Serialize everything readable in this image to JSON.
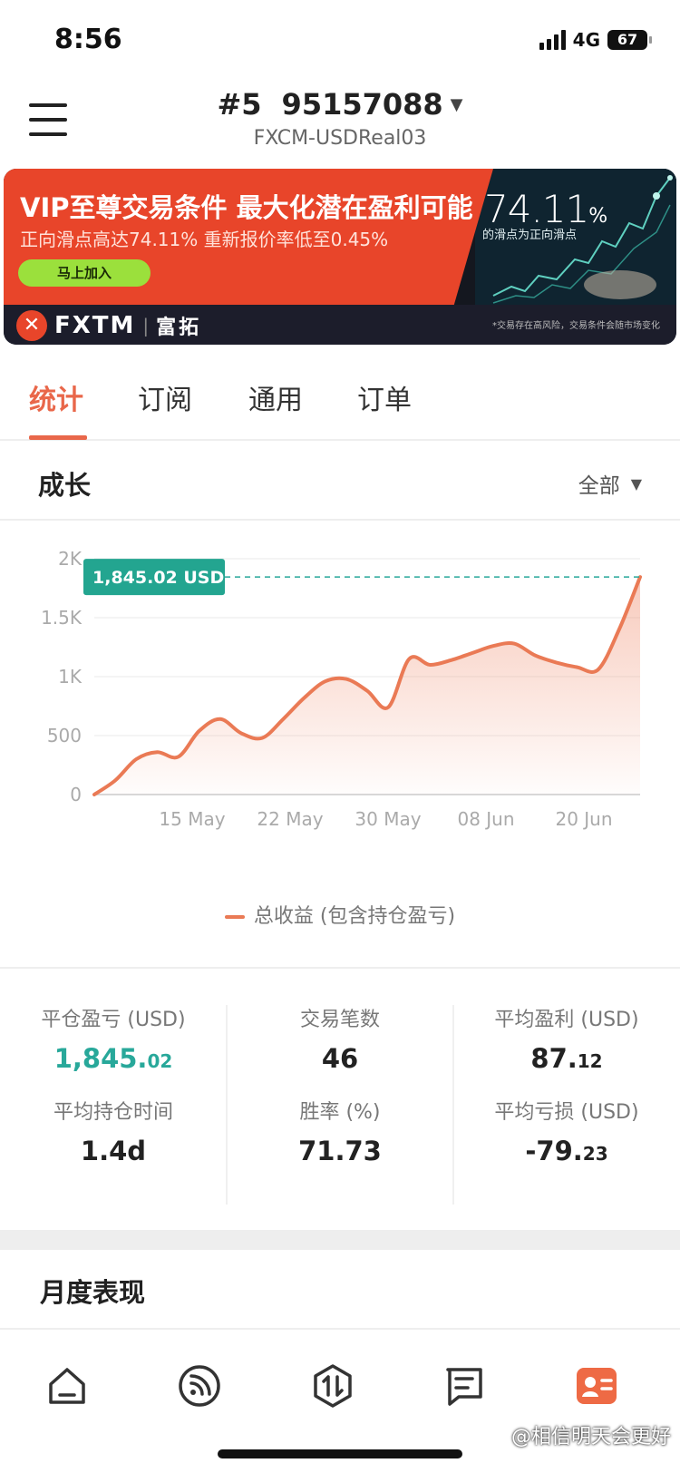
{
  "status_bar": {
    "time": "8:56",
    "network": "4G",
    "battery": "67"
  },
  "header": {
    "account_rank": "#5",
    "account_number": "95157088",
    "server": "FXCM-USDReal03"
  },
  "banner": {
    "title": "VIP至尊交易条件 最大化潜在盈利可能",
    "subtitle": "正向滑点高达74.11% 重新报价率低至0.45%",
    "cta": "马上加入",
    "big_percent_value": "74.11",
    "big_percent_symbol": "%",
    "percent_label": "的滑点为正向滑点",
    "brand": "FXTM",
    "brand_separator": "|",
    "brand_cn": "富拓",
    "disclaimer": "*交易存在高风险，交易条件会随市场变化"
  },
  "tabs": [
    {
      "label": "统计",
      "active": true
    },
    {
      "label": "订阅",
      "active": false
    },
    {
      "label": "通用",
      "active": false
    },
    {
      "label": "订单",
      "active": false
    }
  ],
  "growth": {
    "title": "成长",
    "filter": "全部"
  },
  "chart_data": {
    "type": "area",
    "title": "",
    "xlabel": "",
    "ylabel": "",
    "ylim": [
      0,
      2000
    ],
    "y_ticks": [
      "0",
      "500",
      "1K",
      "1.5K",
      "2K"
    ],
    "x_tick_labels": [
      "15 May",
      "22 May",
      "30 May",
      "08 Jun",
      "20 Jun"
    ],
    "series": [
      {
        "name": "总收益 (包含持仓盈亏)",
        "color": "#ea7a55",
        "x": [
          "05-05",
          "05-07",
          "05-09",
          "05-11",
          "05-13",
          "05-15",
          "05-17",
          "05-19",
          "05-21",
          "05-23",
          "05-25",
          "05-27",
          "05-29",
          "05-31",
          "06-02",
          "06-04",
          "06-06",
          "06-08",
          "06-10",
          "06-12",
          "06-14",
          "06-16",
          "06-18",
          "06-20",
          "06-22",
          "06-24",
          "06-26"
        ],
        "values": [
          0,
          120,
          300,
          360,
          320,
          540,
          640,
          520,
          480,
          640,
          820,
          960,
          980,
          880,
          740,
          1150,
          1100,
          1140,
          1200,
          1260,
          1280,
          1180,
          1120,
          1080,
          1060,
          1400,
          1845.02
        ]
      }
    ],
    "current_value_label": "1,845.02 USD",
    "legend_position": "bottom"
  },
  "stats": [
    {
      "label": "平仓盈亏 (USD)",
      "int": "1,845.",
      "dec": "02",
      "green": true
    },
    {
      "label": "交易笔数",
      "int": "46",
      "dec": "",
      "green": false
    },
    {
      "label": "平均盈利 (USD)",
      "int": "87.",
      "dec": "12",
      "green": false
    },
    {
      "label": "平均持仓时间",
      "int": "1.4d",
      "dec": "",
      "green": false
    },
    {
      "label": "胜率 (%)",
      "int": "71.73",
      "dec": "",
      "green": false
    },
    {
      "label": "平均亏损 (USD)",
      "int": "-79.",
      "dec": "23",
      "green": false
    }
  ],
  "monthly": {
    "title": "月度表现"
  },
  "bottom_nav": [
    {
      "icon": "home-icon",
      "active": false
    },
    {
      "icon": "feed-icon",
      "active": false
    },
    {
      "icon": "trade-icon",
      "active": false
    },
    {
      "icon": "orders-icon",
      "active": false
    },
    {
      "icon": "profile-card-icon",
      "active": true
    }
  ],
  "watermark": "@相信明天会更好",
  "colors": {
    "accent": "#e9674a",
    "positive": "#28a89a",
    "line": "#ea7a55"
  }
}
